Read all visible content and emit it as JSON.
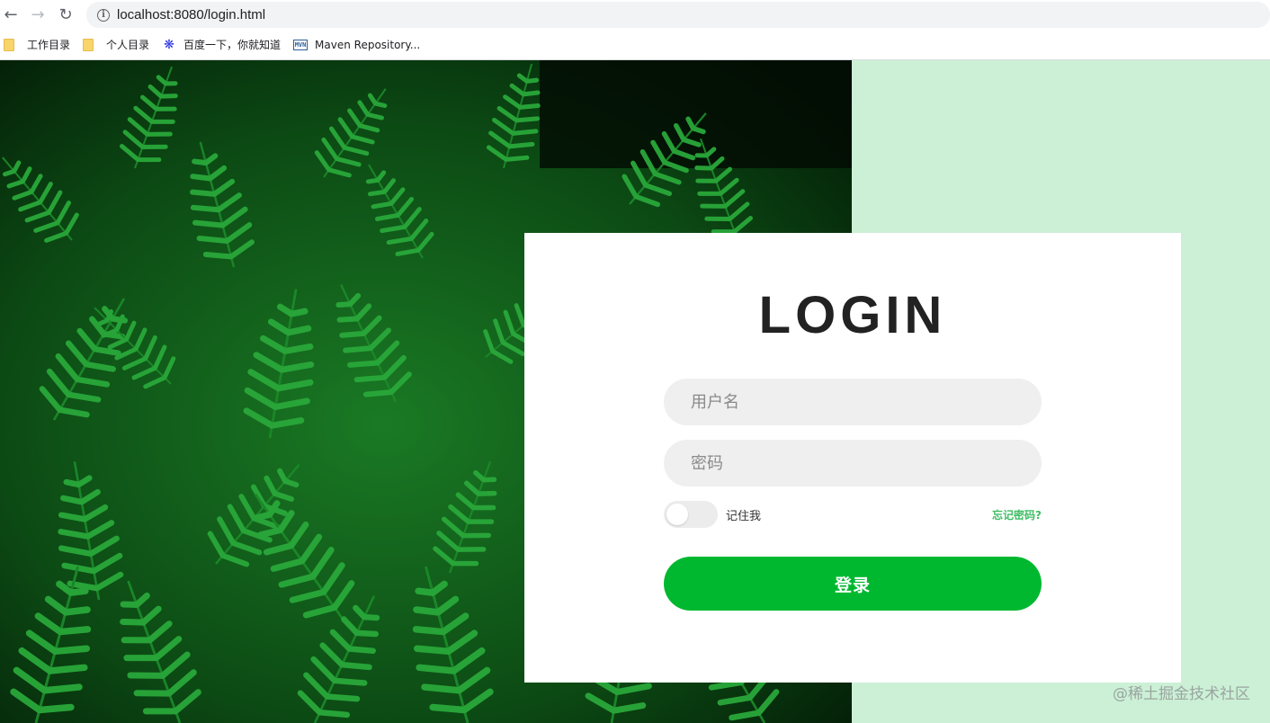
{
  "browser": {
    "url": "localhost:8080/login.html",
    "bookmarks": [
      {
        "label": "工作目录",
        "icon": "folder-icon"
      },
      {
        "label": "个人目录",
        "icon": "folder-icon"
      },
      {
        "label": "百度一下，你就知道",
        "icon": "baidu-paw-icon"
      },
      {
        "label": "Maven Repository...",
        "icon": "maven-icon",
        "icon_text": "MVN"
      }
    ]
  },
  "login": {
    "title": "LOGIN",
    "username_placeholder": "用户名",
    "password_placeholder": "密码",
    "remember_label": "记住我",
    "remember_checked": false,
    "forgot_label": "忘记密码?",
    "submit_label": "登录"
  },
  "colors": {
    "page_background": "#cbf0d6",
    "accent_green": "#00b82f",
    "link_green": "#3fbe63",
    "input_background": "#efefef"
  },
  "watermark": "@稀土掘金技术社区"
}
